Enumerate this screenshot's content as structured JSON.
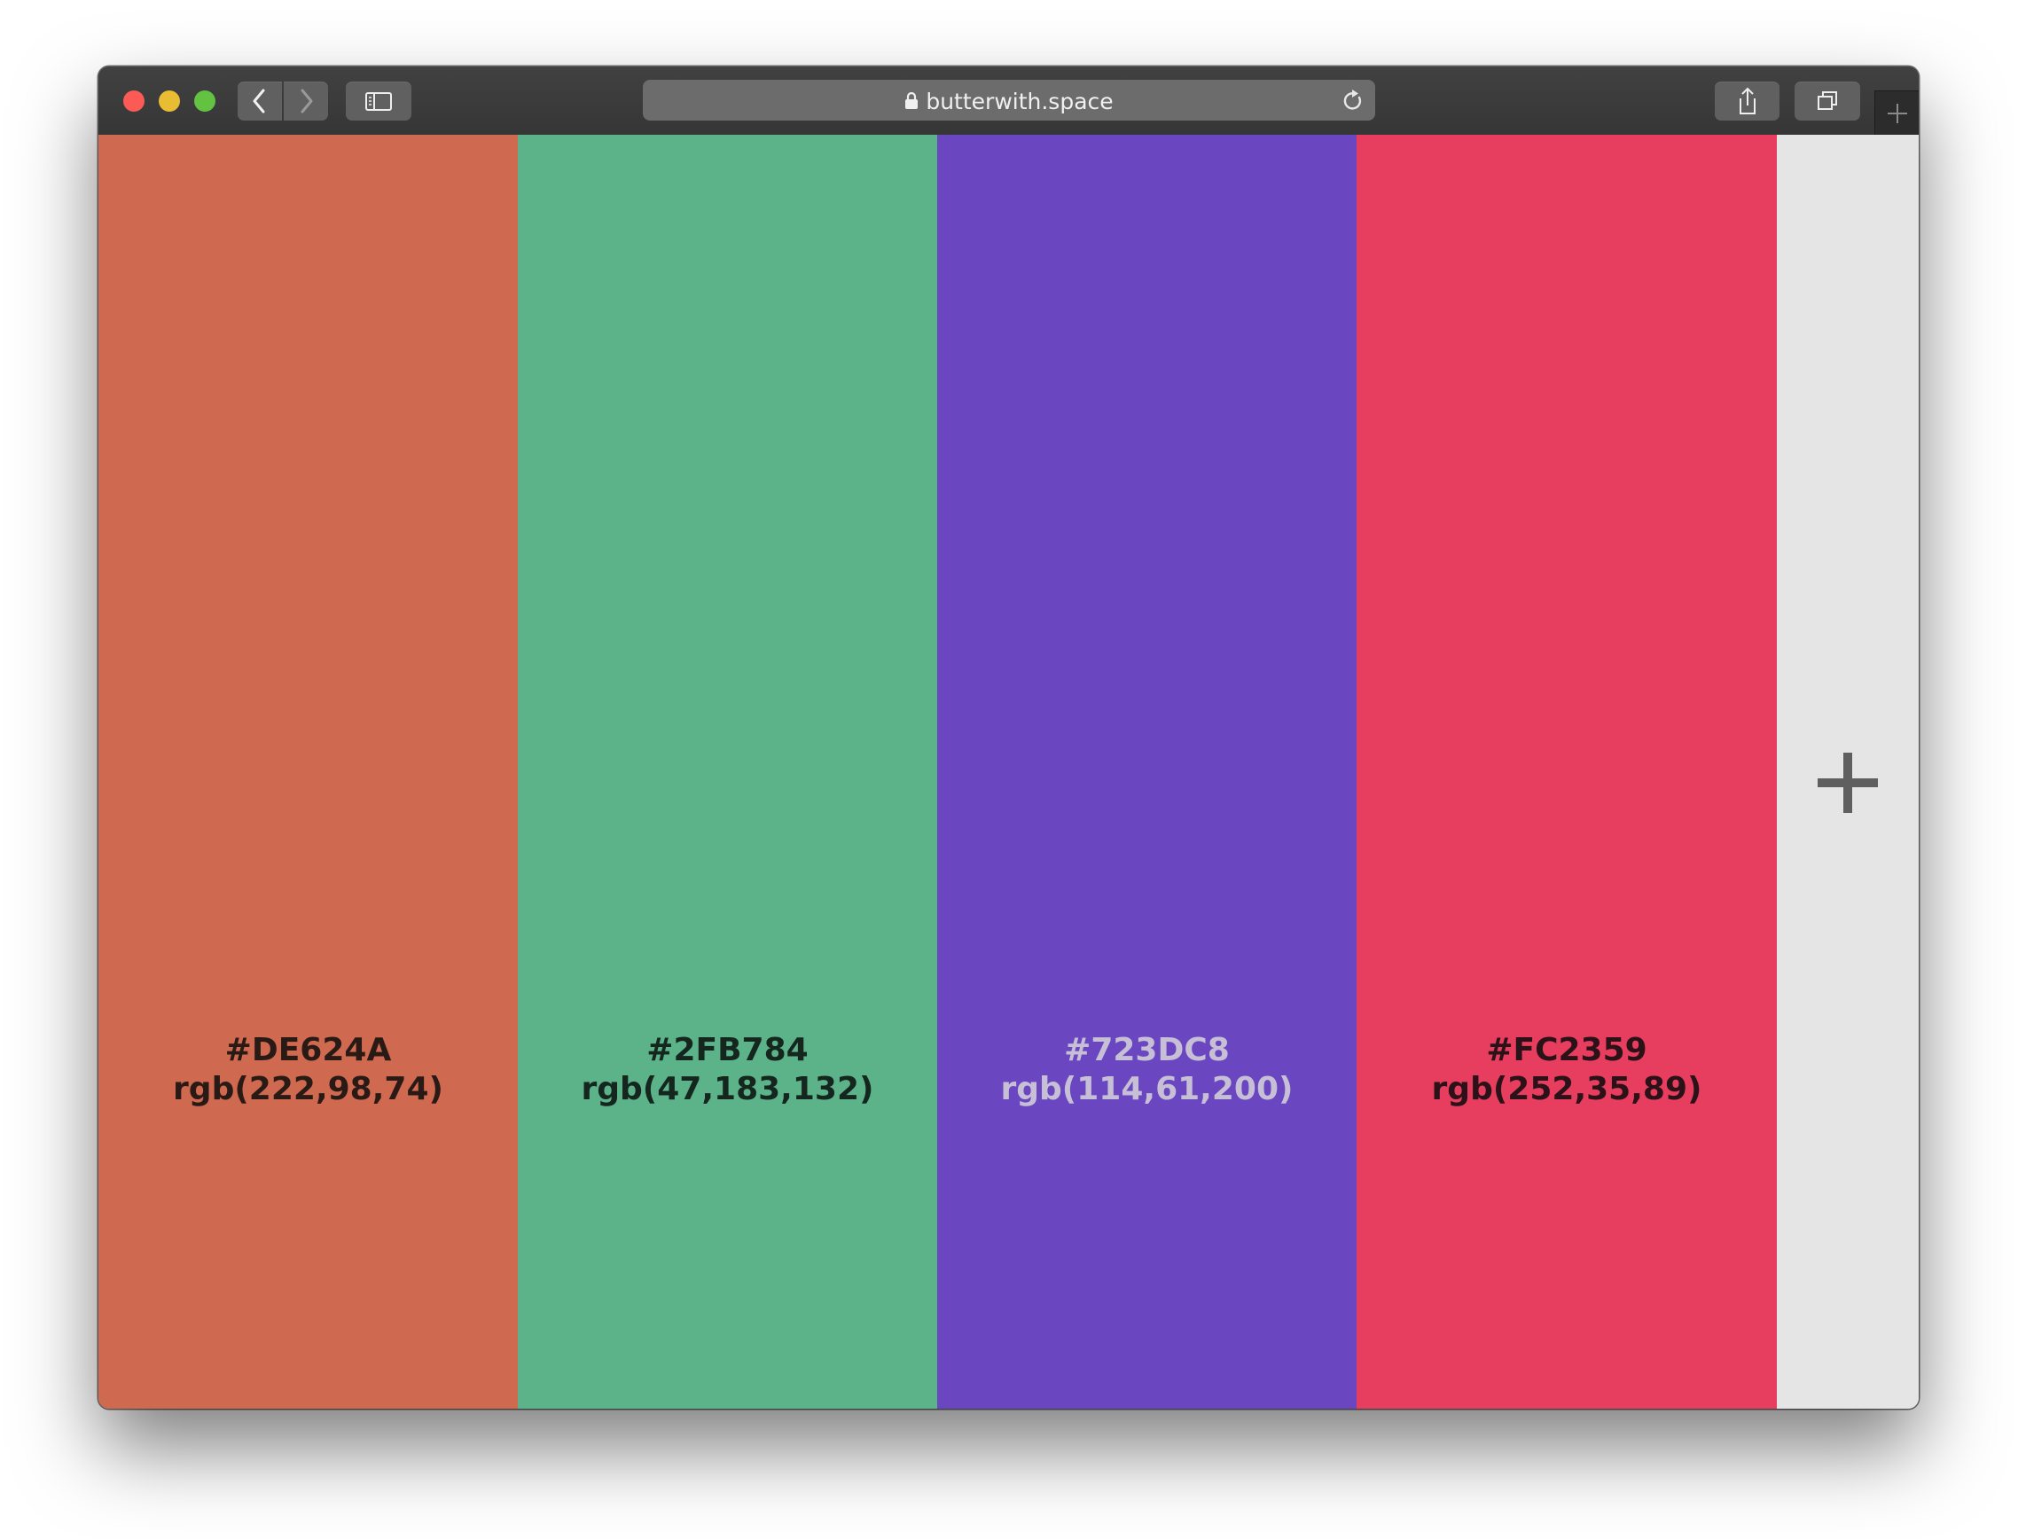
{
  "browser": {
    "url": "butterwith.space",
    "lock_icon": "lock-icon",
    "buttons": [
      "back-button",
      "forward-button",
      "sidebar-button",
      "share-button",
      "tabs-button",
      "new-tab-button"
    ]
  },
  "swatches": [
    {
      "hex": "#DE624A",
      "rgb": "rgb(222,98,74)",
      "text_color": "#2a1a16"
    },
    {
      "hex": "#2FB784",
      "rgb": "rgb(47,183,132)",
      "text_color": "#14261e"
    },
    {
      "hex": "#723DC8",
      "rgb": "rgb(114,61,200)",
      "text_color": "#c7bfd6"
    },
    {
      "hex": "#FC2359",
      "rgb": "rgb(252,35,89)",
      "text_color": "#2a1218"
    }
  ],
  "display_colors": [
    "#cf6950",
    "#5cb38a",
    "#6a46c1",
    "#e73d5e"
  ],
  "add_color_icon": "plus-icon"
}
